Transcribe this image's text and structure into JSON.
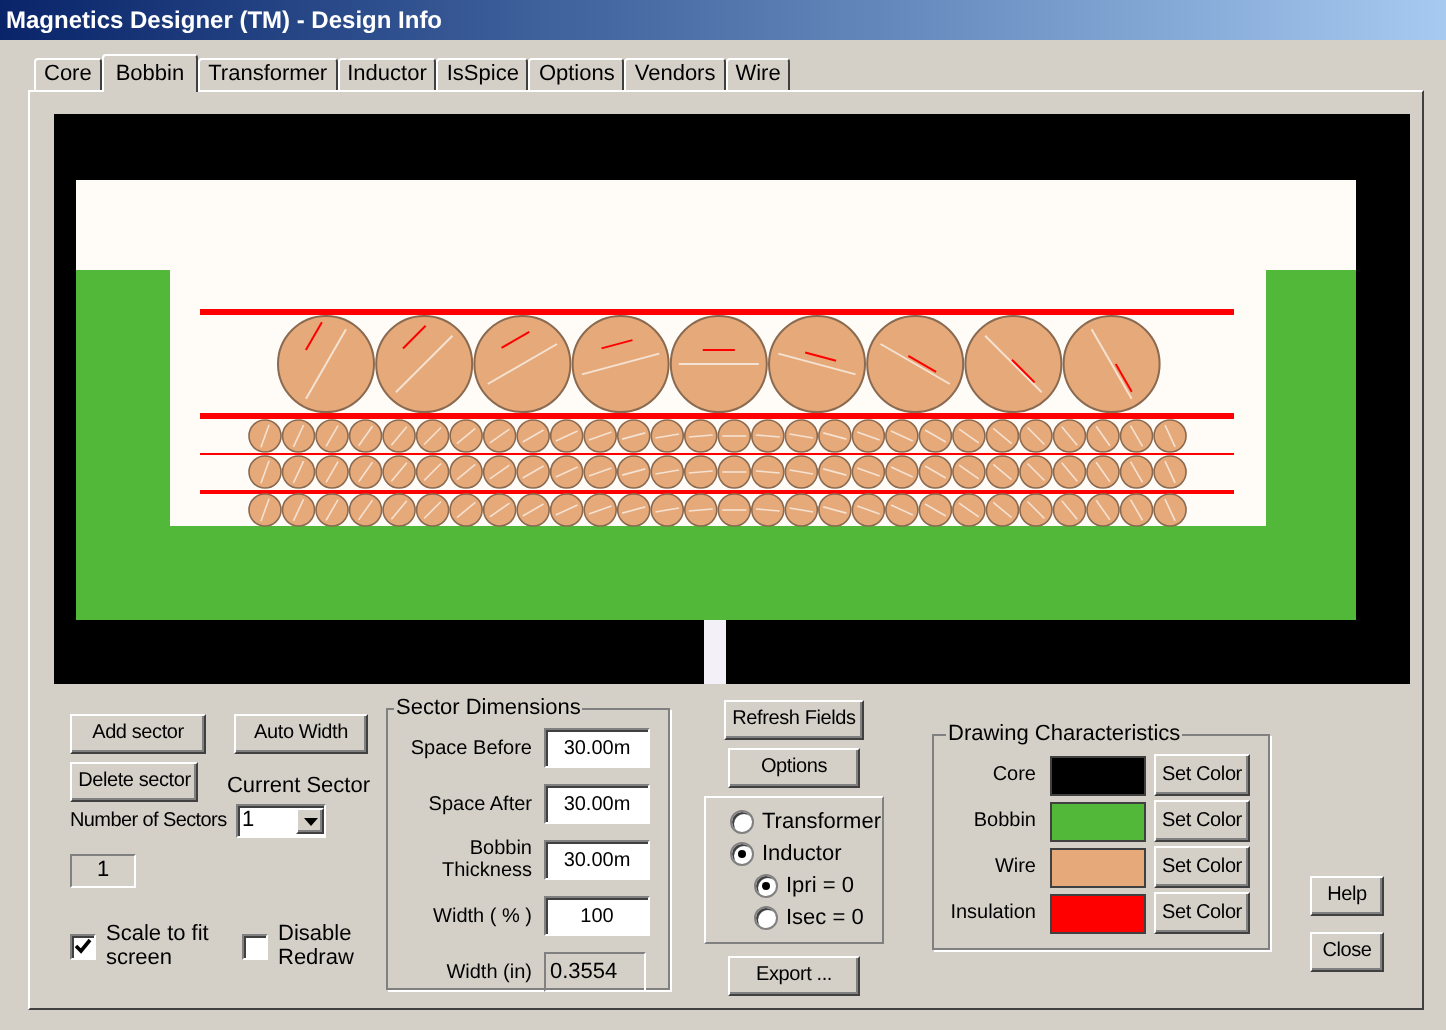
{
  "window": {
    "title": "Magnetics Designer (TM) - Design Info"
  },
  "tabs": [
    {
      "label": "Core",
      "selected": false
    },
    {
      "label": "Bobbin",
      "selected": true
    },
    {
      "label": "Transformer",
      "selected": false
    },
    {
      "label": "Inductor",
      "selected": false
    },
    {
      "label": "IsSpice",
      "selected": false
    },
    {
      "label": "Options",
      "selected": false
    },
    {
      "label": "Vendors",
      "selected": false
    },
    {
      "label": "Wire",
      "selected": false
    }
  ],
  "sector_controls": {
    "add_button": "Add sector",
    "auto_width_button": "Auto Width",
    "delete_button": "Delete sector",
    "current_sector_label": "Current Sector",
    "current_sector_value": "1",
    "number_of_sectors_label": "Number of Sectors",
    "number_of_sectors_value": "1"
  },
  "checkboxes": [
    {
      "label": "Scale to fit screen",
      "checked": true
    },
    {
      "label": "Disable Redraw",
      "checked": false
    }
  ],
  "sector_dimensions": {
    "title": "Sector Dimensions",
    "fields": [
      {
        "label": "Space Before",
        "value": "30.00m",
        "readonly": false
      },
      {
        "label": "Space After",
        "value": "30.00m",
        "readonly": false
      },
      {
        "label": "Bobbin Thickness",
        "value": "30.00m",
        "readonly": false
      },
      {
        "label": "Width ( % )",
        "value": "100",
        "readonly": false
      },
      {
        "label": "Width (in)",
        "value": "0.3554",
        "readonly": true
      }
    ]
  },
  "refresh_button": "Refresh Fields",
  "options_button": "Options",
  "mode": [
    {
      "label": "Transformer",
      "selected": false
    },
    {
      "label": "Inductor",
      "selected": true,
      "children": [
        {
          "label": "Ipri = 0",
          "selected": true
        },
        {
          "label": "Isec = 0",
          "selected": false
        }
      ]
    }
  ],
  "export_button": "Export ...",
  "drawing_characteristics": {
    "title": "Drawing Characteristics",
    "items": [
      {
        "label": "Core",
        "color": "#000000",
        "button": "Set Color"
      },
      {
        "label": "Bobbin",
        "color": "#52b83a",
        "button": "Set Color"
      },
      {
        "label": "Wire",
        "color": "#e6a97a",
        "button": "Set Color"
      },
      {
        "label": "Insulation",
        "color": "#ff0000",
        "button": "Set Color"
      }
    ]
  },
  "help_button": "Help",
  "close_button": "Close"
}
